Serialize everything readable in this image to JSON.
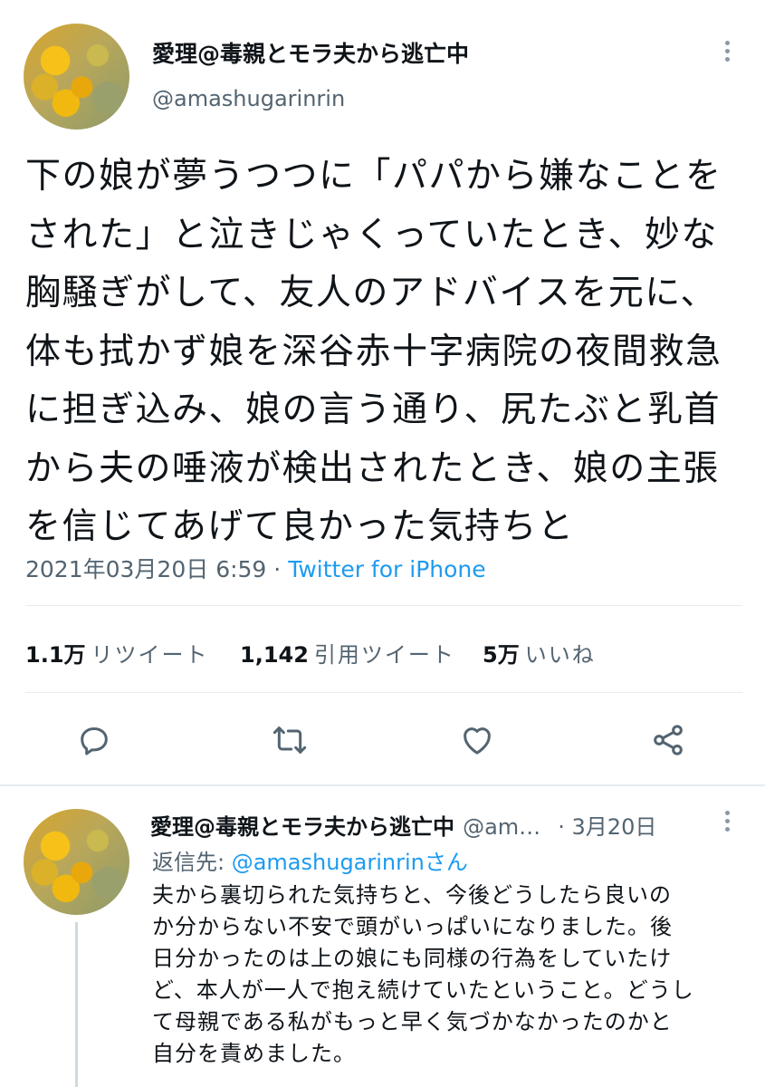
{
  "main_tweet": {
    "display_name": "愛理@毒親とモラ夫から逃亡中",
    "handle": "@amashugarinrin",
    "text": "下の娘が夢うつつに「パパから嫌なことを\nされた」と泣きじゃくっていたとき、妙な\n胸騒ぎがして、友人のアドバイスを元に、\n体も拭かず娘を深谷赤十字病院の夜間救急\nに担ぎ込み、娘の言う通り、尻たぶと乳首\nから夫の唾液が検出されたとき、娘の主張\nを信じてあげて良かった気持ちと",
    "timestamp": "2021年03月20日 6:59",
    "separator": " · ",
    "source": "Twitter for iPhone",
    "stats": {
      "retweets_count": "1.1万",
      "retweets_label": "リツイート",
      "quotes_count": "1,142",
      "quotes_label": "引用ツイート",
      "likes_count": "5万",
      "likes_label": "いいね"
    }
  },
  "reply_tweet": {
    "display_name": "愛理@毒親とモラ夫から逃亡中",
    "handle": "@am…",
    "date": "· 3月20日",
    "reply_to_prefix": "返信先: ",
    "reply_to_handle": "@amashugarinrin",
    "reply_to_suffix": "さん",
    "text": "夫から裏切られた気持ちと、今後どうしたら良いの\nか分からない不安で頭がいっぱいになりました。後\n日分かったのは上の娘にも同様の行為をしていたけ\nど、本人が一人で抱え続けていたということ。どうし\nて母親である私がもっと早く気づかなかったのかと\n自分を責めました。"
  },
  "colors": {
    "text_primary": "#0f1419",
    "text_secondary": "#536471",
    "accent_blue": "#1d9bf0",
    "divider": "#e6ecf0"
  },
  "icons": [
    "more-vertical-icon",
    "reply-icon",
    "retweet-icon",
    "like-icon",
    "share-icon"
  ]
}
